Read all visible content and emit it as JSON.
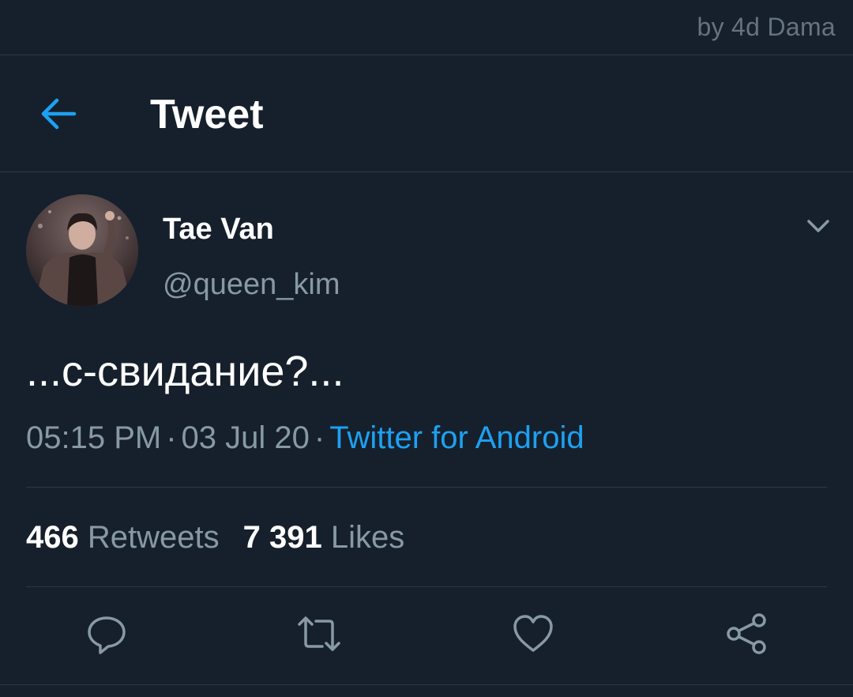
{
  "watermark": "by 4d Dama",
  "header": {
    "title": "Tweet",
    "back_icon": "arrow-left-icon"
  },
  "tweet": {
    "author_name": "Tae Van",
    "author_handle": "@queen_kim",
    "text": "...с-свидание?...",
    "time": "05:15 PM",
    "separator": "·",
    "date": "03 Jul 20",
    "source": "Twitter for Android"
  },
  "stats": {
    "retweets_count": "466",
    "retweets_label": "Retweets",
    "likes_count": "7 391",
    "likes_label": "Likes"
  },
  "actions": [
    {
      "name": "reply",
      "icon": "speech-bubble-icon"
    },
    {
      "name": "retweet",
      "icon": "retweet-icon"
    },
    {
      "name": "like",
      "icon": "heart-icon"
    },
    {
      "name": "share",
      "icon": "share-icon"
    }
  ],
  "colors": {
    "background": "#16202c",
    "accent": "#1da1f2",
    "secondary_text": "#8899a6",
    "divider": "#2b3846"
  }
}
